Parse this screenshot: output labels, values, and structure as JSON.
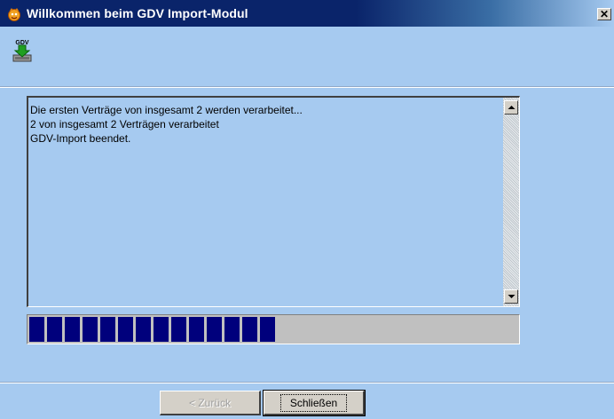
{
  "window": {
    "title": "Willkommen beim GDV Import-Modul",
    "close_glyph": "✕"
  },
  "header": {
    "logo_icon": "gdv-download-icon",
    "logo_text": "GDV"
  },
  "log": {
    "lines": [
      "Die ersten Verträge von insgesamt 2 werden verarbeitet...",
      "2 von insgesamt 2 Verträgen verarbeitet",
      "GDV-Import beendet."
    ]
  },
  "progress": {
    "fraction": 0.51,
    "color": "#00007C"
  },
  "buttons": {
    "back_label": "< Zurück",
    "close_label": "Schließen"
  },
  "colors": {
    "background": "#A6CAF0",
    "titlebar": "#0A246A"
  }
}
